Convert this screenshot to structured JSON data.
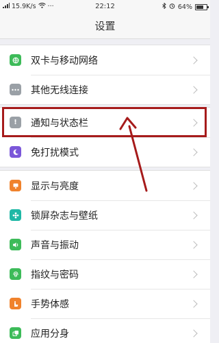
{
  "status_bar": {
    "carrier": "15.9K/s",
    "dots": "···",
    "time": "22:12",
    "battery_percent": "64%",
    "battery_level": 0.64
  },
  "navbar": {
    "title": "设置"
  },
  "groups": [
    {
      "items": [
        {
          "label": "双卡与移动网络",
          "icon": "sim-card-icon",
          "color": "#3dbb59"
        },
        {
          "label": "其他无线连接",
          "icon": "more-icon",
          "color": "#9aa0a6"
        }
      ]
    },
    {
      "items": [
        {
          "label": "通知与状态栏",
          "icon": "notification-icon",
          "color": "#9aa0a6"
        },
        {
          "label": "免打扰模式",
          "icon": "moon-icon",
          "color": "#7b57d9"
        }
      ]
    },
    {
      "items": [
        {
          "label": "显示与亮度",
          "icon": "display-icon",
          "color": "#f0822c"
        },
        {
          "label": "锁屏杂志与壁纸",
          "icon": "wallpaper-icon",
          "color": "#1fb8a6"
        },
        {
          "label": "声音与振动",
          "icon": "sound-icon",
          "color": "#3dbb59"
        },
        {
          "label": "指纹与密码",
          "icon": "fingerprint-icon",
          "color": "#3dbb59"
        },
        {
          "label": "手势体感",
          "icon": "gesture-icon",
          "color": "#f0822c"
        },
        {
          "label": "应用分身",
          "icon": "app-clone-icon",
          "color": "#3dbb59"
        }
      ]
    }
  ],
  "annotation": {
    "highlight_color": "#a61b1b"
  }
}
